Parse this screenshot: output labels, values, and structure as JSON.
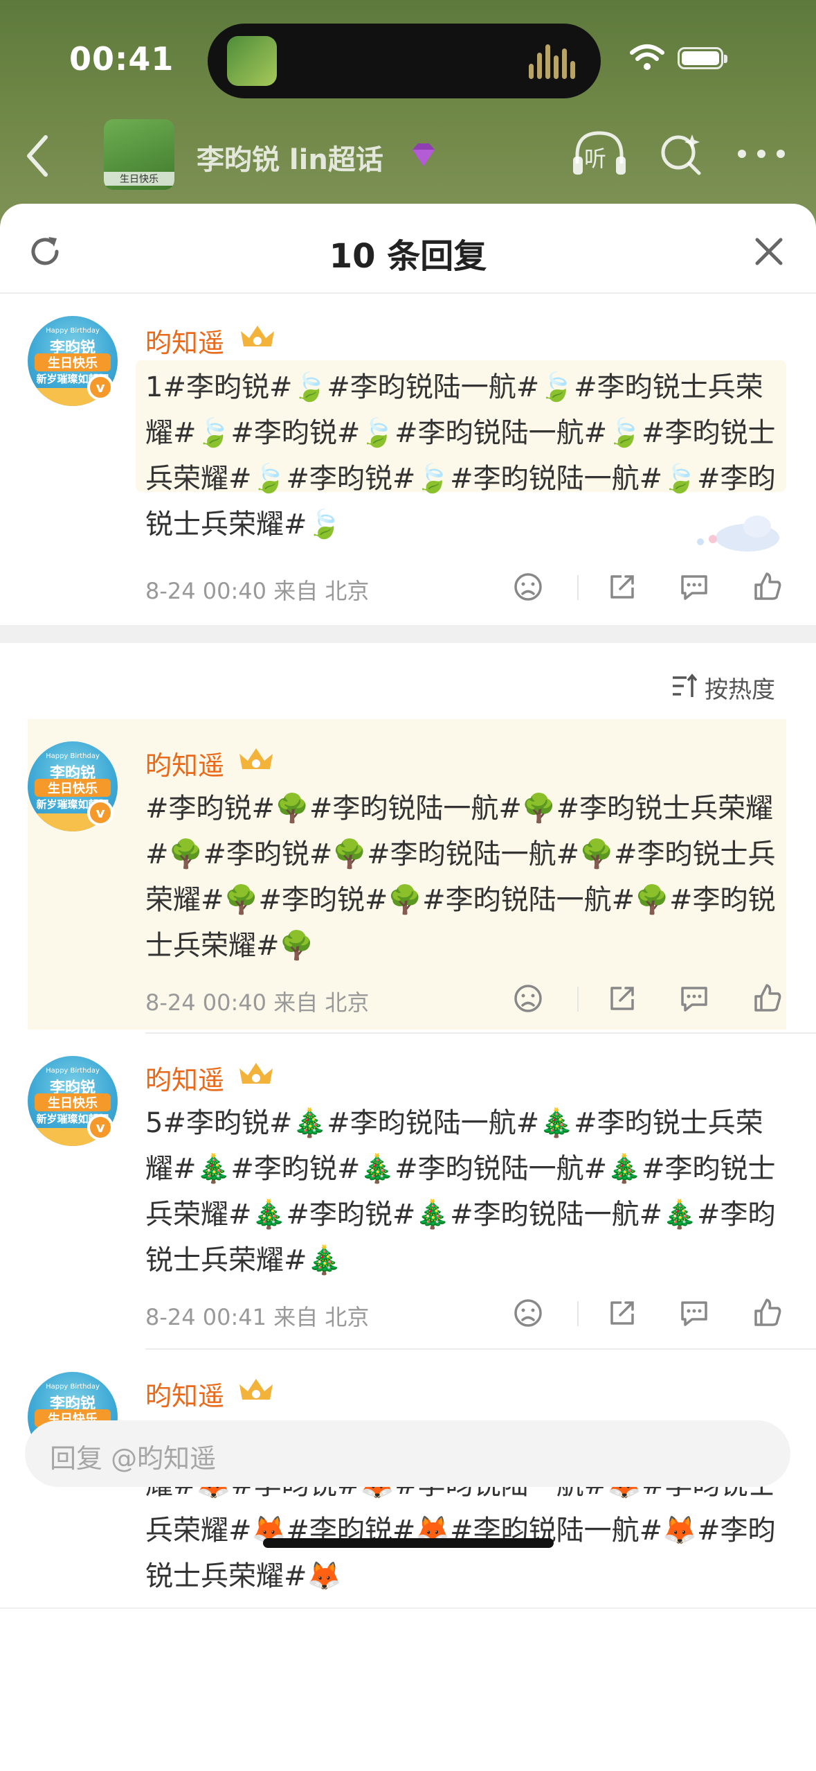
{
  "status_bar": {
    "time": "00:41"
  },
  "nav": {
    "title": "李昀锐 lin超话",
    "avatar_caption": "生日快乐",
    "listen_label": "听"
  },
  "sheet": {
    "title": "10 条回复"
  },
  "avatar_text": {
    "top": "Happy Birthday",
    "line1": "李昀锐",
    "line2": "生日快乐",
    "line3": "新岁璀璨如朝阳",
    "badge": "v"
  },
  "comments": [
    {
      "username": "昀知遥",
      "text": "1#李昀锐#🍃#李昀锐陆一航#🍃#李昀锐士兵荣耀#🍃#李昀锐#🍃#李昀锐陆一航#🍃#李昀锐士兵荣耀#🍃#李昀锐#🍃#李昀锐陆一航#🍃#李昀锐士兵荣耀#🍃",
      "meta": "8-24 00:40 来自 北京"
    },
    {
      "username": "昀知遥",
      "text": "#李昀锐#🌳#李昀锐陆一航#🌳#李昀锐士兵荣耀#🌳#李昀锐#🌳#李昀锐陆一航#🌳#李昀锐士兵荣耀#🌳#李昀锐#🌳#李昀锐陆一航#🌳#李昀锐士兵荣耀#🌳",
      "meta": "8-24 00:40 来自 北京"
    },
    {
      "username": "昀知遥",
      "text": "5#李昀锐#🎄#李昀锐陆一航#🎄#李昀锐士兵荣耀#🎄#李昀锐#🎄#李昀锐陆一航#🎄#李昀锐士兵荣耀#🎄#李昀锐#🎄#李昀锐陆一航#🎄#李昀锐士兵荣耀#🎄",
      "meta": "8-24 00:41 来自 北京"
    },
    {
      "username": "昀知遥",
      "text": "4#李昀锐#🦊#李昀锐陆一航#🦊#李昀锐士兵荣耀#🦊#李昀锐#🦊#李昀锐陆一航#🦊#李昀锐士兵荣耀#🦊#李昀锐#🦊#李昀锐陆一航#🦊#李昀锐士兵荣耀#🦊"
    }
  ],
  "sort": {
    "label": "按热度"
  },
  "reply": {
    "placeholder": "回复 @昀知遥"
  },
  "colors": {
    "username": "#e86a1a",
    "highlight": "#fdf9ea",
    "accent": "#f59a2a"
  }
}
